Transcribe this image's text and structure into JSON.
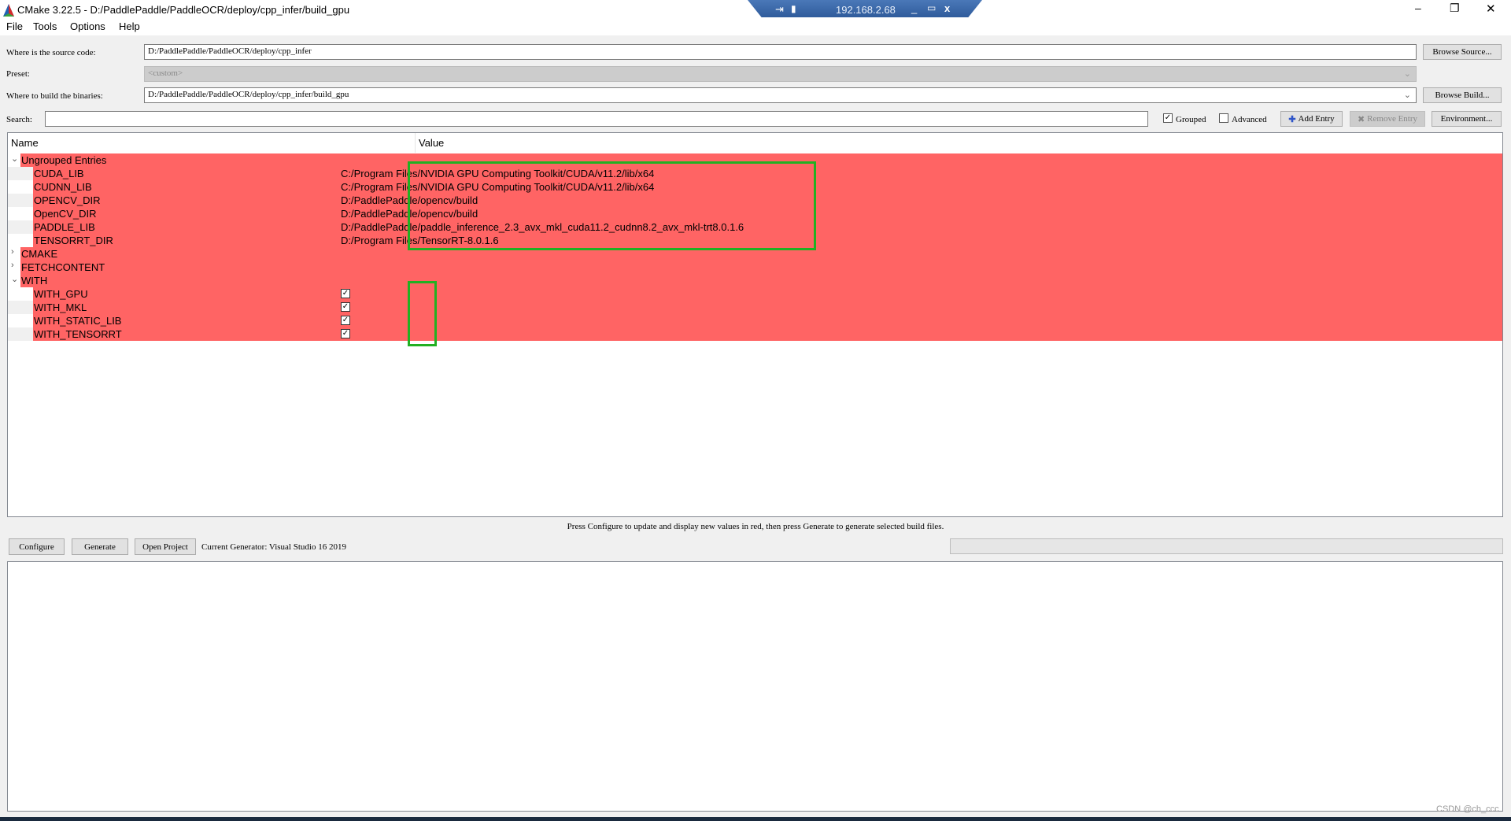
{
  "window": {
    "title": "CMake 3.22.5 - D:/PaddlePaddle/PaddleOCR/deploy/cpp_infer/build_gpu",
    "remote_ip": "192.168.2.68"
  },
  "menu": [
    "File",
    "Tools",
    "Options",
    "Help"
  ],
  "source": {
    "label": "Where is the source code:",
    "value": "D:/PaddlePaddle/PaddleOCR/deploy/cpp_infer",
    "button": "Browse Source..."
  },
  "preset": {
    "label": "Preset:",
    "value": "<custom>"
  },
  "build": {
    "label": "Where to build the binaries:",
    "value": "D:/PaddlePaddle/PaddleOCR/deploy/cpp_infer/build_gpu",
    "button": "Browse Build..."
  },
  "search": {
    "label": "Search:",
    "value": "",
    "grouped": "Grouped",
    "grouped_checked": true,
    "advanced": "Advanced",
    "advanced_checked": false,
    "add_entry": "Add Entry",
    "remove_entry": "Remove Entry",
    "environment": "Environment..."
  },
  "tree": {
    "headers": [
      "Name",
      "Value"
    ],
    "highlight_color": "#ff6464",
    "rows": [
      {
        "name": "Ungrouped Entries",
        "group": true,
        "expanded": true,
        "value": ""
      },
      {
        "name": "CUDA_LIB",
        "value": "C:/Program Files/NVIDIA GPU Computing Toolkit/CUDA/v11.2/lib/x64"
      },
      {
        "name": "CUDNN_LIB",
        "value": "C:/Program Files/NVIDIA GPU Computing Toolkit/CUDA/v11.2/lib/x64"
      },
      {
        "name": "OPENCV_DIR",
        "value": "D:/PaddlePaddle/opencv/build"
      },
      {
        "name": "OpenCV_DIR",
        "value": "D:/PaddlePaddle/opencv/build"
      },
      {
        "name": "PADDLE_LIB",
        "value": "D:/PaddlePaddle/paddle_inference_2.3_avx_mkl_cuda11.2_cudnn8.2_avx_mkl-trt8.0.1.6"
      },
      {
        "name": "TENSORRT_DIR",
        "value": "D:/Program Files/TensorRT-8.0.1.6"
      },
      {
        "name": "CMAKE",
        "group": true,
        "expanded": false,
        "value": ""
      },
      {
        "name": "FETCHCONTENT",
        "group": true,
        "expanded": false,
        "value": ""
      },
      {
        "name": "WITH",
        "group": true,
        "expanded": true,
        "value": ""
      },
      {
        "name": "WITH_GPU",
        "checkbox": true,
        "checked": true
      },
      {
        "name": "WITH_MKL",
        "checkbox": true,
        "checked": true
      },
      {
        "name": "WITH_STATIC_LIB",
        "checkbox": true,
        "checked": true
      },
      {
        "name": "WITH_TENSORRT",
        "checkbox": true,
        "checked": true
      }
    ]
  },
  "message": "Press Configure to update and display new values in red, then press Generate to generate selected build files.",
  "actions": {
    "configure": "Configure",
    "generate": "Generate",
    "open_project": "Open Project",
    "generator": "Current Generator: Visual Studio 16 2019"
  },
  "watermark": "CSDN @ch_ccc"
}
